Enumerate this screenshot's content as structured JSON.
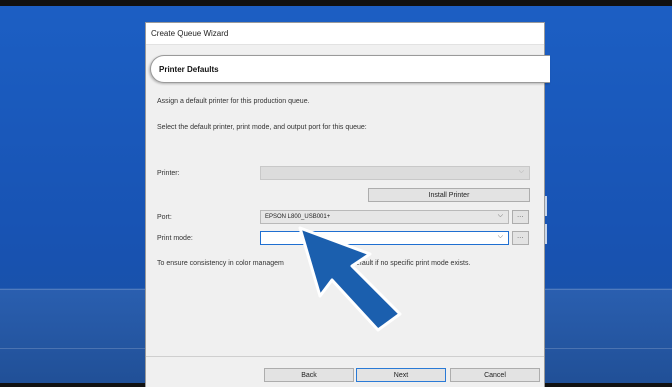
{
  "window": {
    "title": "Create Queue Wizard"
  },
  "header": {
    "title": "Printer Defaults"
  },
  "intro": {
    "line1": "Assign a default printer for this production queue.",
    "line2": "Select the default printer, print mode, and output port for this queue:"
  },
  "form": {
    "printer_label": "Printer:",
    "printer_value": "",
    "install_button": "Install Printer",
    "port_label": "Port:",
    "port_value": "EPSON L800_USB001+",
    "port_browse": "...",
    "print_mode_label": "Print mode:",
    "print_mode_value": "",
    "print_mode_browse": "...",
    "note_left": "To ensure consistency in color managem",
    "note_right": "efault if no specific print mode exists."
  },
  "footer": {
    "back": "Back",
    "next": "Next",
    "cancel": "Cancel"
  },
  "icons": {
    "chevron": "chevron-down-icon",
    "cursor": "arrow-cursor-icon"
  },
  "colors": {
    "desktop": "#1c5fc4",
    "cursor_fill": "#1b5fae",
    "accent_border": "#1f6fd1"
  }
}
